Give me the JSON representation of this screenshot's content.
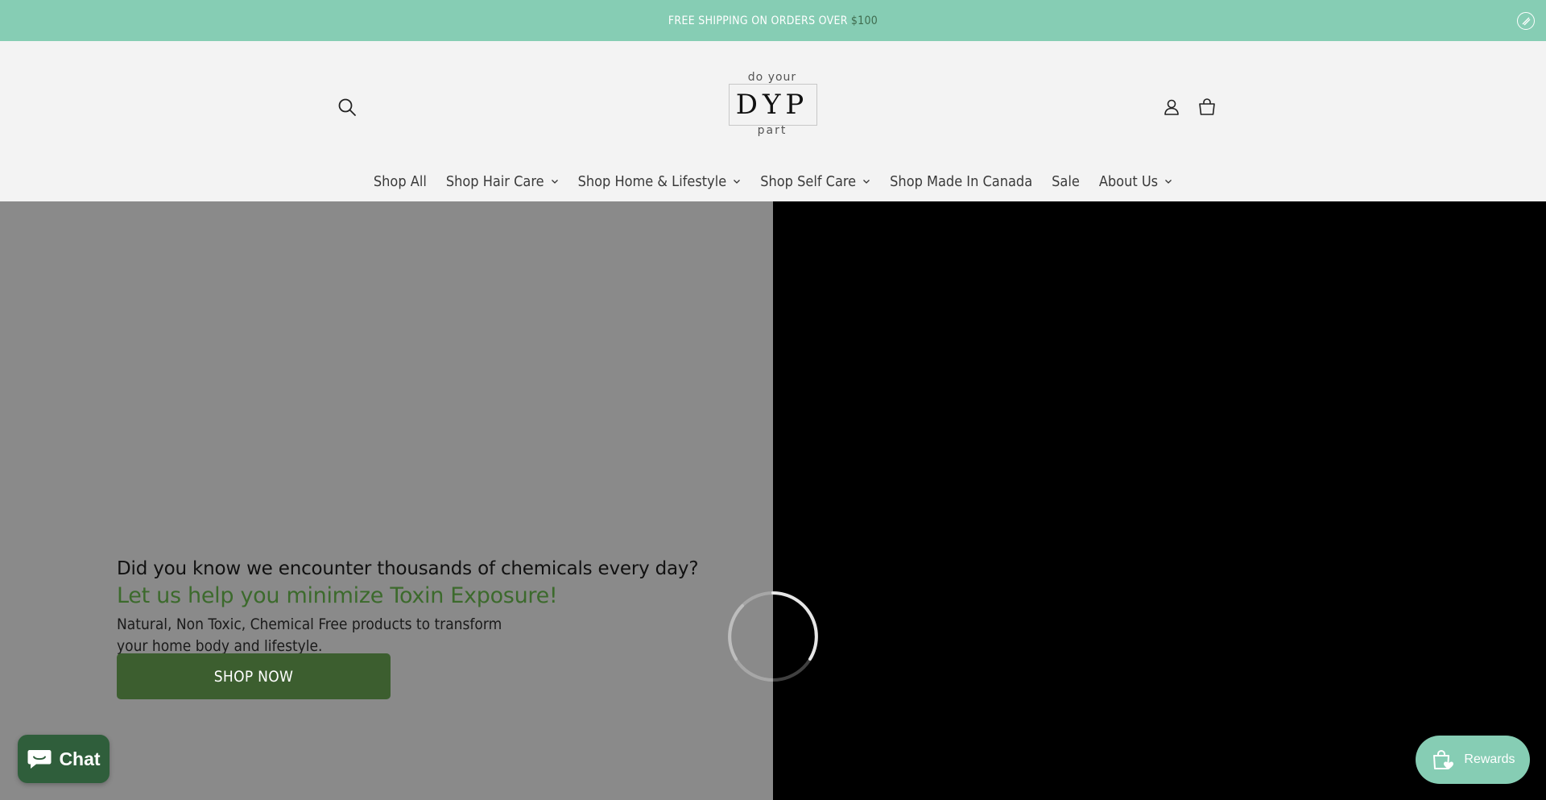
{
  "announcement": {
    "text": "FREE SHIPPING ON ORDERS OVER",
    "amount": "$100"
  },
  "logo": {
    "top": "do your",
    "middle": "DYP",
    "bottom": "part"
  },
  "nav": {
    "items": [
      {
        "label": "Shop All",
        "dropdown": false
      },
      {
        "label": "Shop Hair Care",
        "dropdown": true
      },
      {
        "label": "Shop Home & Lifestyle",
        "dropdown": true
      },
      {
        "label": "Shop Self Care",
        "dropdown": true
      },
      {
        "label": "Shop Made In Canada",
        "dropdown": false
      },
      {
        "label": "Sale",
        "dropdown": false
      },
      {
        "label": "About Us",
        "dropdown": true
      }
    ]
  },
  "hero": {
    "question": "Did you know we encounter thousands of chemicals every day?",
    "tagline": "Let us help you minimize Toxin Exposure!",
    "description": "Natural, Non Toxic, Chemical Free products to transform your home body and lifestyle.",
    "button_label": "SHOP NOW"
  },
  "widgets": {
    "chat_label": "Chat",
    "rewards_label": "Rewards"
  },
  "colors": {
    "announce_bg": "#86cdb4",
    "brand_green": "#3c5e2f",
    "tagline_green": "#3c6a2c"
  }
}
